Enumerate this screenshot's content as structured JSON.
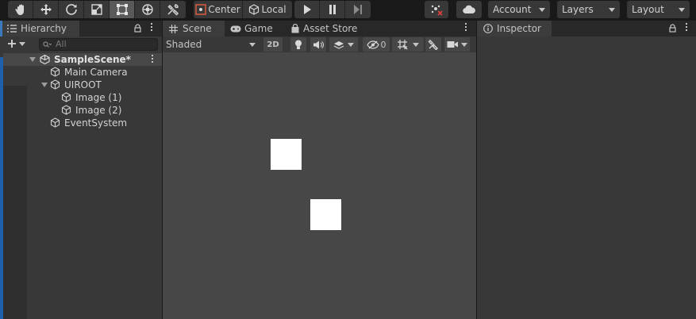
{
  "toolbar": {
    "tools": [
      {
        "name": "hand-tool",
        "icon": "hand-icon"
      },
      {
        "name": "move-tool",
        "icon": "move-icon"
      },
      {
        "name": "rotate-tool",
        "icon": "rotate-icon"
      },
      {
        "name": "scale-tool",
        "icon": "scale-icon"
      },
      {
        "name": "rect-tool",
        "icon": "rect-icon",
        "active": true
      },
      {
        "name": "transform-tool",
        "icon": "transform-icon"
      },
      {
        "name": "custom-tool",
        "icon": "tools-icon"
      }
    ],
    "pivot_label": "Center",
    "space_label": "Local",
    "play_icon": "play-icon",
    "pause_icon": "pause-icon",
    "step_icon": "step-icon",
    "account_label": "Account",
    "layers_label": "Layers",
    "layout_label": "Layout"
  },
  "hierarchy": {
    "tab_label": "Hierarchy",
    "search_placeholder": "All",
    "items": [
      {
        "label": "SampleScene*",
        "depth": 0,
        "kind": "scene",
        "expanded": true
      },
      {
        "label": "Main Camera",
        "depth": 1,
        "kind": "object"
      },
      {
        "label": "UIROOT",
        "depth": 1,
        "kind": "object",
        "expanded": true
      },
      {
        "label": "Image (1)",
        "depth": 2,
        "kind": "object"
      },
      {
        "label": "Image (2)",
        "depth": 2,
        "kind": "object"
      },
      {
        "label": "EventSystem",
        "depth": 1,
        "kind": "object"
      }
    ]
  },
  "scene": {
    "tabs": [
      {
        "label": "Scene",
        "icon": "scene-grid-icon",
        "active": true
      },
      {
        "label": "Game",
        "icon": "gamepad-icon",
        "active": false
      },
      {
        "label": "Asset Store",
        "icon": "shopping-bag-icon",
        "active": false
      }
    ],
    "shading_mode": "Shaded",
    "mode_2d_label": "2D",
    "hidden_count": "0",
    "colors": {
      "viewport": "#474747",
      "ui_image": "#ffffff"
    }
  },
  "inspector": {
    "tab_label": "Inspector"
  },
  "colors": {
    "accent": "#3a79bb",
    "panel": "#383838",
    "toolbar": "#191919"
  }
}
